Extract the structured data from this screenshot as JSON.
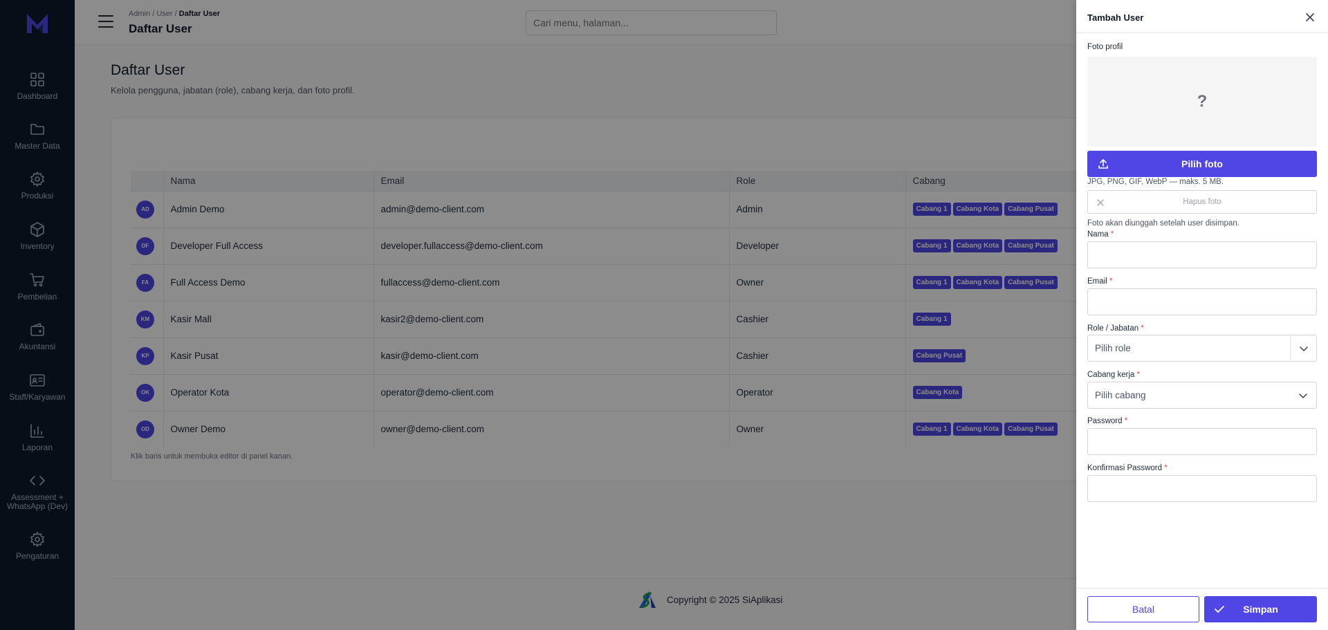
{
  "sidebar": {
    "items": [
      {
        "label": "Dashboard",
        "icon": "grid-icon"
      },
      {
        "label": "Master Data",
        "icon": "folder-icon"
      },
      {
        "label": "Produksi",
        "icon": "gear-icon"
      },
      {
        "label": "Inventory",
        "icon": "box-icon"
      },
      {
        "label": "Pembelian",
        "icon": "cart-icon"
      },
      {
        "label": "Akuntansi",
        "icon": "wallet-icon"
      },
      {
        "label": "Staff/Karyawan",
        "icon": "id-card-icon"
      },
      {
        "label": "Laporan",
        "icon": "bar-chart-icon"
      },
      {
        "label": "Assessment + WhatsApp (Dev)",
        "icon": "code-icon"
      },
      {
        "label": "Pengaturan",
        "icon": "gear-icon"
      }
    ]
  },
  "topbar": {
    "breadcrumb_prefix": "Admin / User /",
    "breadcrumb_current": "Daftar User",
    "title": "Daftar User",
    "search_placeholder": "Cari menu, halaman..."
  },
  "page": {
    "title": "Daftar User",
    "subtitle": "Kelola pengguna, jabatan (role), cabang kerja, dan foto profil."
  },
  "table": {
    "columns": [
      "",
      "Nama",
      "Email",
      "Role",
      "Cabang"
    ],
    "rows": [
      {
        "initials": "AD",
        "name": "Admin Demo",
        "email": "admin@demo-client.com",
        "role": "Admin",
        "branches": [
          "Cabang 1",
          "Cabang Kota",
          "Cabang Pusat"
        ]
      },
      {
        "initials": "DF",
        "name": "Developer Full Access",
        "email": "developer.fullaccess@demo-client.com",
        "role": "Developer",
        "branches": [
          "Cabang 1",
          "Cabang Kota",
          "Cabang Pusat"
        ]
      },
      {
        "initials": "FA",
        "name": "Full Access Demo",
        "email": "fullaccess@demo-client.com",
        "role": "Owner",
        "branches": [
          "Cabang 1",
          "Cabang Kota",
          "Cabang Pusat"
        ]
      },
      {
        "initials": "KM",
        "name": "Kasir Mall",
        "email": "kasir2@demo-client.com",
        "role": "Cashier",
        "branches": [
          "Cabang 1"
        ]
      },
      {
        "initials": "KP",
        "name": "Kasir Pusat",
        "email": "kasir@demo-client.com",
        "role": "Cashier",
        "branches": [
          "Cabang Pusat"
        ]
      },
      {
        "initials": "OK",
        "name": "Operator Kota",
        "email": "operator@demo-client.com",
        "role": "Operator",
        "branches": [
          "Cabang Kota"
        ]
      },
      {
        "initials": "OD",
        "name": "Owner Demo",
        "email": "owner@demo-client.com",
        "role": "Owner",
        "branches": [
          "Cabang 1",
          "Cabang Kota",
          "Cabang Pusat"
        ]
      }
    ],
    "hint": "Klik baris untuk membuka editor di panel kanan."
  },
  "footer": {
    "copyright": "Copyright © 2025 SiAplikasi"
  },
  "drawer": {
    "title": "Tambah User",
    "photo_label": "Foto profil",
    "photo_placeholder": "?",
    "choose_photo": "Pilih foto",
    "formats": "JPG, PNG, GIF, WebP — maks. 5 MB.",
    "delete_photo": "Hapus foto",
    "upload_note": "Foto akan diunggah setelah user disimpan.",
    "name_label": "Nama",
    "email_label": "Email",
    "role_label": "Role / Jabatan",
    "role_placeholder": "Pilih role",
    "branch_label": "Cabang kerja",
    "branch_placeholder": "Pilih cabang",
    "password_label": "Password",
    "confirm_label": "Konfirmasi Password",
    "required_mark": "*",
    "cancel": "Batal",
    "save": "Simpan"
  },
  "colors": {
    "accent": "#4f46e5",
    "sidebar_bg": "#0f1b2d"
  }
}
